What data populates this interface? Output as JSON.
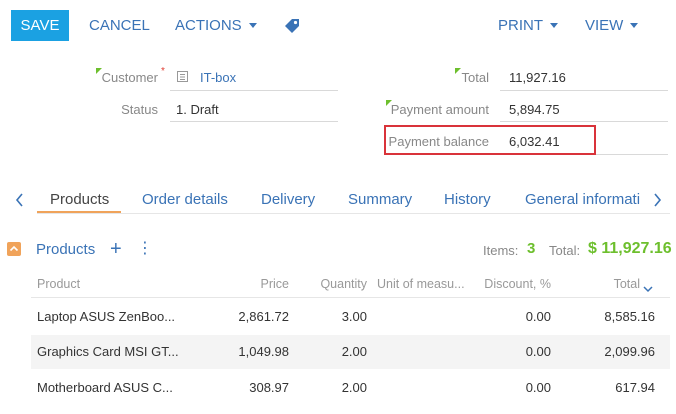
{
  "toolbar": {
    "save_label": "SAVE",
    "cancel_label": "CANCEL",
    "actions_label": "ACTIONS",
    "print_label": "PRINT",
    "view_label": "VIEW",
    "tag_icon": "tag-icon"
  },
  "form": {
    "customer_label": "Customer",
    "customer_required_mark": "*",
    "customer_value": "IT-box",
    "status_label": "Status",
    "status_value": "1. Draft",
    "total_label": "Total",
    "total_value": "11,927.16",
    "payment_amount_label": "Payment amount",
    "payment_amount_value": "5,894.75",
    "payment_balance_label": "Payment balance",
    "payment_balance_value": "6,032.41"
  },
  "tabs": [
    {
      "label": "Products",
      "active": true
    },
    {
      "label": "Order details",
      "active": false
    },
    {
      "label": "Delivery",
      "active": false
    },
    {
      "label": "Summary",
      "active": false
    },
    {
      "label": "History",
      "active": false
    },
    {
      "label": "General informati",
      "active": false
    }
  ],
  "products": {
    "title": "Products",
    "add_icon": "+",
    "menu_icon": "⋮",
    "items_label": "Items:",
    "items_count": "3",
    "total_label": "Total:",
    "total_value": "$ 11,927.16",
    "columns": [
      "Product",
      "Price",
      "Quantity",
      "Unit of measu...",
      "Discount, %",
      "Total"
    ],
    "rows": [
      {
        "product": "Laptop ASUS ZenBoo...",
        "price": "2,861.72",
        "quantity": "3.00",
        "unit": "",
        "discount": "0.00",
        "total": "8,585.16"
      },
      {
        "product": "Graphics Card MSI GT...",
        "price": "1,049.98",
        "quantity": "2.00",
        "unit": "",
        "discount": "0.00",
        "total": "2,099.96"
      },
      {
        "product": "Motherboard ASUS C...",
        "price": "308.97",
        "quantity": "2.00",
        "unit": "",
        "discount": "0.00",
        "total": "617.94"
      }
    ]
  },
  "colors": {
    "accent": "#1ba1e2",
    "link": "#3a73b6",
    "highlight_border": "#d9333a",
    "green_total": "#6dbf2d",
    "collapse_toggle": "#f0a35a"
  }
}
